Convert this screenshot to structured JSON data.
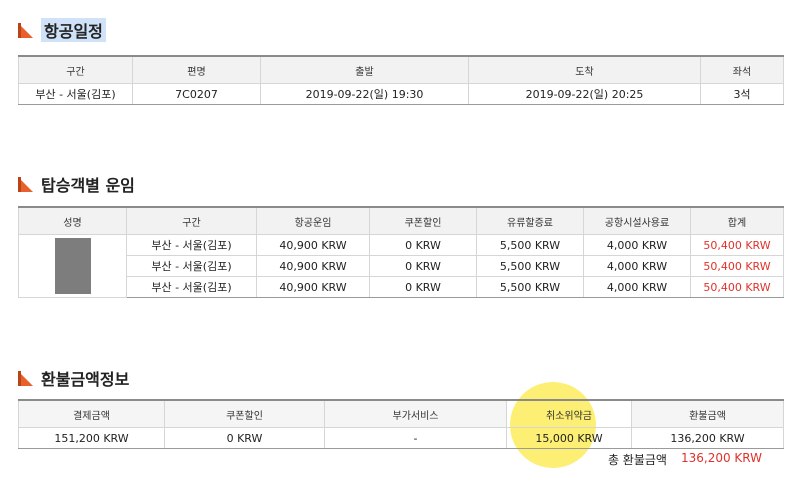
{
  "sections": {
    "flight": {
      "title": "항공일정"
    },
    "fare": {
      "title": "탑승객별 운임"
    },
    "refund": {
      "title": "환불금액정보"
    }
  },
  "flight_table": {
    "headers": [
      "구간",
      "편명",
      "출발",
      "도착",
      "좌석"
    ],
    "row": [
      "부산 - 서울(김포)",
      "7C0207",
      "2019-09-22(일) 19:30",
      "2019-09-22(일) 20:25",
      "3석"
    ]
  },
  "fare_table": {
    "headers": [
      "성명",
      "구간",
      "항공운임",
      "쿠폰할인",
      "유류할증료",
      "공항시설사용료",
      "합계"
    ],
    "rows": [
      [
        "부산 - 서울(김포)",
        "40,900 KRW",
        "0 KRW",
        "5,500 KRW",
        "4,000 KRW",
        "50,400 KRW"
      ],
      [
        "부산 - 서울(김포)",
        "40,900 KRW",
        "0 KRW",
        "5,500 KRW",
        "4,000 KRW",
        "50,400 KRW"
      ],
      [
        "부산 - 서울(김포)",
        "40,900 KRW",
        "0 KRW",
        "5,500 KRW",
        "4,000 KRW",
        "50,400 KRW"
      ]
    ]
  },
  "refund_table": {
    "headers": [
      "결제금액",
      "쿠폰할인",
      "부가서비스",
      "취소위약금",
      "환불금액"
    ],
    "row": [
      "151,200 KRW",
      "0 KRW",
      "-",
      "15,000 KRW",
      "136,200 KRW"
    ]
  },
  "total": {
    "label": "총 환불금액",
    "value": "136,200 KRW"
  },
  "colors": {
    "accent": "#e8602c",
    "total_red": "#e0322b",
    "highlight": "#fcec5a"
  }
}
